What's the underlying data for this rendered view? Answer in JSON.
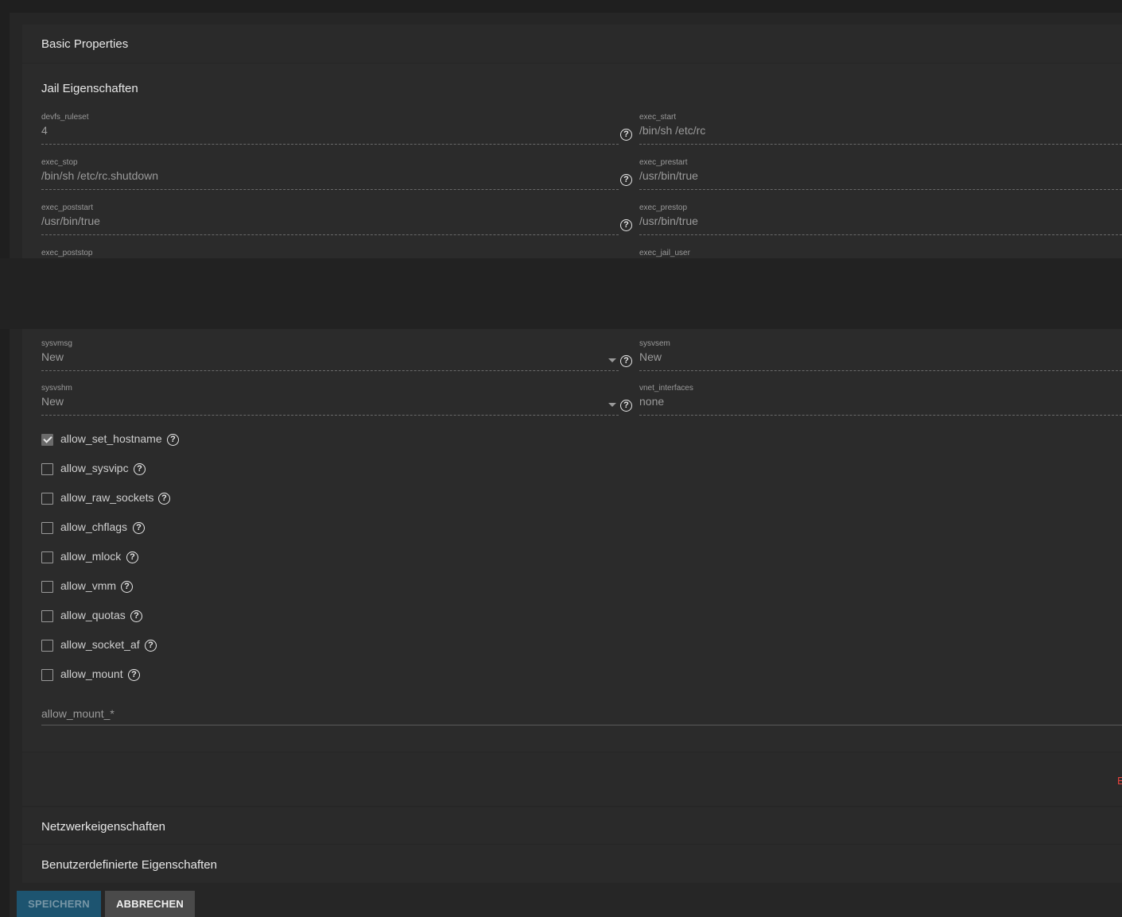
{
  "sections": {
    "basic": "Basic Properties",
    "jail": "Jail Eigenschaften",
    "network": "Netzwerkeigenschaften",
    "custom": "Benutzerdefinierte Eigenschaften"
  },
  "fields_top": [
    {
      "label": "devfs_ruleset",
      "value": "4"
    },
    {
      "label": "exec_start",
      "value": "/bin/sh /etc/rc"
    },
    {
      "label": "exec_stop",
      "value": "/bin/sh /etc/rc.shutdown"
    },
    {
      "label": "exec_prestart",
      "value": "/usr/bin/true"
    },
    {
      "label": "exec_poststart",
      "value": "/usr/bin/true"
    },
    {
      "label": "exec_prestop",
      "value": "/usr/bin/true"
    },
    {
      "label": "exec_poststop",
      "value": ""
    },
    {
      "label": "exec_jail_user",
      "value": ""
    }
  ],
  "fields_bottom": [
    {
      "label": "sysvmsg",
      "value": "New"
    },
    {
      "label": "sysvsem",
      "value": "New"
    },
    {
      "label": "sysvshm",
      "value": "New"
    },
    {
      "label": "vnet_interfaces",
      "value": "none"
    }
  ],
  "checkboxes": [
    {
      "label": "allow_set_hostname",
      "checked": true
    },
    {
      "label": "allow_sysvipc",
      "checked": false
    },
    {
      "label": "allow_raw_sockets",
      "checked": false
    },
    {
      "label": "allow_chflags",
      "checked": false
    },
    {
      "label": "allow_mlock",
      "checked": false
    },
    {
      "label": "allow_vmm",
      "checked": false
    },
    {
      "label": "allow_quotas",
      "checked": false
    },
    {
      "label": "allow_socket_af",
      "checked": false
    },
    {
      "label": "allow_mount",
      "checked": false
    }
  ],
  "allow_mount_field": {
    "placeholder": "allow_mount_*"
  },
  "error_fragment": "E",
  "help_glyph": "?",
  "icons": {
    "help": "help-circle-icon",
    "dropdown": "caret-down-icon",
    "check": "check-icon"
  },
  "buttons": {
    "save": "SPEICHERN",
    "cancel": "ABBRECHEN"
  },
  "colors": {
    "save_bg": "#1d5470",
    "cancel_bg": "#4a4a4a",
    "error": "#e8423c"
  }
}
